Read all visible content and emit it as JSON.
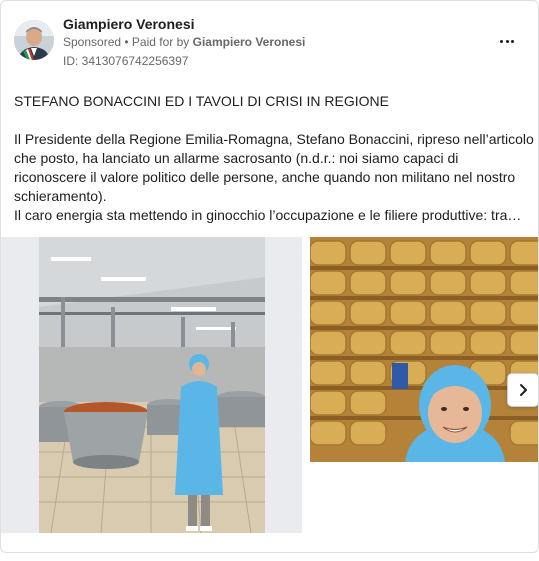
{
  "post": {
    "author": "Giampiero Veronesi",
    "sponsored": "Sponsored",
    "paid_prefix": "• Paid for by",
    "paid_by": "Giampiero Veronesi",
    "ad_id": "ID: 3413076742256397",
    "headline": "STEFANO BONACCINI ED I TAVOLI DI CRISI IN REGIONE",
    "body_lines": [
      "Il Presidente della Regione Emilia-Romagna, Stefano Bonaccini, ripreso nell’articolo",
      "che posto, ha lanciato un allarme sacrosanto (n.d.r.: noi siamo capaci di",
      "riconoscere il valore politico delle persone, anche quando non militano nel nostro",
      "schieramento).",
      "Il caro energia sta mettendo in ginocchio l’occupazione e le filiere produttive: tra…"
    ]
  },
  "icons": {
    "more": "more-horizontal-icon",
    "next": "chevron-right-icon"
  },
  "colors": {
    "text": "#1c1e21",
    "secondary": "#65676b",
    "border": "#dddfe2",
    "hairnet": "#5ab6e6",
    "cheese": "#d6a84a"
  }
}
